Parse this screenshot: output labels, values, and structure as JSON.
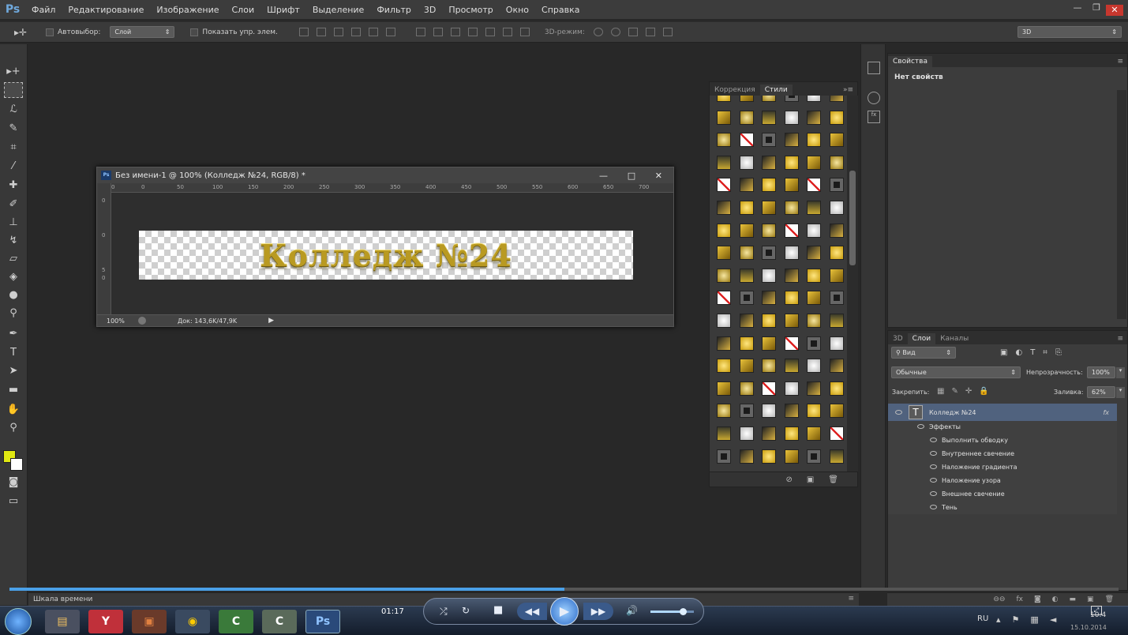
{
  "menubar": {
    "logo": "Ps",
    "items": [
      "Файл",
      "Редактирование",
      "Изображение",
      "Слои",
      "Шрифт",
      "Выделение",
      "Фильтр",
      "3D",
      "Просмотр",
      "Окно",
      "Справка"
    ],
    "window_controls": [
      "—",
      "❐",
      "✕"
    ]
  },
  "options": {
    "autoselect_label": "Автовыбор:",
    "autoselect_value": "Слой",
    "show_transform_label": "Показать упр. элем.",
    "mode3d_label": "3D-режим:",
    "workspace_value": "3D"
  },
  "document": {
    "title": "Без имени-1 @ 100% (Колледж №24, RGB/8) *",
    "canvas_text": "Колледж №24",
    "zoom": "100%",
    "doc_info": "Док: 143,6K/47,9K",
    "ruler_h": [
      "0",
      "0",
      "50",
      "100",
      "150",
      "200",
      "250",
      "300",
      "350",
      "400",
      "450",
      "500",
      "550",
      "600",
      "650",
      "700"
    ],
    "ruler_v": [
      "0",
      "0",
      "5",
      "0"
    ]
  },
  "styles_panel": {
    "tabs": [
      "Коррекция",
      "Стили"
    ],
    "active_tab": "Стили"
  },
  "properties_panel": {
    "tab": "Свойства",
    "empty_text": "Нет свойств"
  },
  "layers_panel": {
    "tabs": [
      "3D",
      "Слои",
      "Каналы"
    ],
    "active_tab": "Слои",
    "filter_label": "Вид",
    "blend_mode": "Обычные",
    "opacity_label": "Непрозрачность:",
    "opacity_value": "100%",
    "lock_label": "Закрепить:",
    "fill_label": "Заливка:",
    "fill_value": "62%",
    "layer_name": "Колледж №24",
    "fx_label": "fx",
    "effects_label": "Эффекты",
    "effects": [
      "Выполнить обводку",
      "Внутреннее свечение",
      "Наложение градиента",
      "Наложение узора",
      "Внешнее свечение",
      "Тень"
    ]
  },
  "timeline": {
    "label": "Шкала времени"
  },
  "player": {
    "time": "01:17",
    "progress": 0.5
  },
  "taskbar": {
    "lang": "RU",
    "clock": "10:4",
    "date": "15.10.2014"
  },
  "colors": {
    "foreground": "#e0e812",
    "background": "#ffffff",
    "accent": "#4aa0e8"
  }
}
